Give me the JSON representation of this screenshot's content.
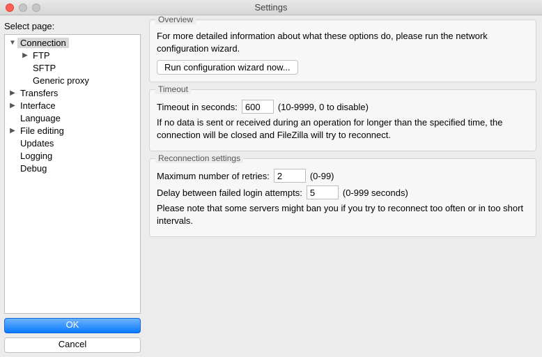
{
  "window": {
    "title": "Settings"
  },
  "sidebar": {
    "label": "Select page:",
    "items": [
      {
        "label": "Connection",
        "expanded": true,
        "selected": true,
        "children": [
          {
            "label": "FTP",
            "hasChildren": true
          },
          {
            "label": "SFTP",
            "hasChildren": false
          },
          {
            "label": "Generic proxy",
            "hasChildren": false
          }
        ]
      },
      {
        "label": "Transfers",
        "hasChildren": true
      },
      {
        "label": "Interface",
        "hasChildren": true
      },
      {
        "label": "Language",
        "hasChildren": false
      },
      {
        "label": "File editing",
        "hasChildren": true
      },
      {
        "label": "Updates",
        "hasChildren": false
      },
      {
        "label": "Logging",
        "hasChildren": false
      },
      {
        "label": "Debug",
        "hasChildren": false
      }
    ],
    "ok": "OK",
    "cancel": "Cancel"
  },
  "overview": {
    "title": "Overview",
    "text": "For more detailed information about what these options do, please run the network configuration wizard.",
    "button": "Run configuration wizard now..."
  },
  "timeout": {
    "title": "Timeout",
    "label": "Timeout in seconds:",
    "value": "600",
    "hint": "(10-9999, 0 to disable)",
    "text": "If no data is sent or received during an operation for longer than the specified time, the connection will be closed and FileZilla will try to reconnect."
  },
  "reconnect": {
    "title": "Reconnection settings",
    "retries_label": "Maximum number of retries:",
    "retries_value": "2",
    "retries_hint": "(0-99)",
    "delay_label": "Delay between failed login attempts:",
    "delay_value": "5",
    "delay_hint": "(0-999 seconds)",
    "note": "Please note that some servers might ban you if you try to reconnect too often or in too short intervals."
  }
}
